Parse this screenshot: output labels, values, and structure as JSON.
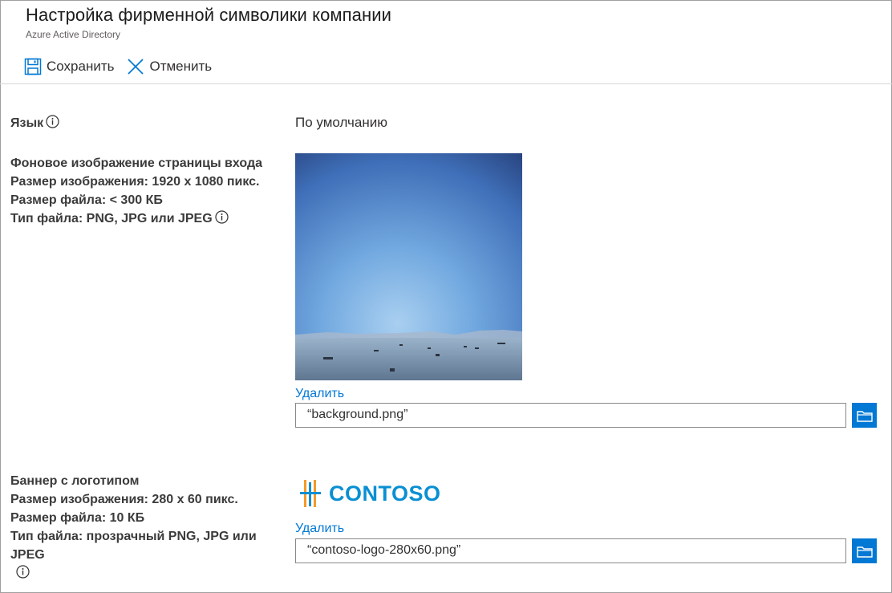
{
  "header": {
    "title": "Настройка фирменной символики компании",
    "subtitle": "Azure Active Directory"
  },
  "toolbar": {
    "save_label": "Сохранить",
    "cancel_label": "Отменить",
    "save_icon": "save-icon",
    "cancel_icon": "close-icon"
  },
  "language": {
    "label": "Язык",
    "value": "По умолчанию"
  },
  "background": {
    "lines": [
      "Фоновое изображение страницы входа",
      "Размер изображения: 1920 x 1080 пикс.",
      "Размер файла: < 300 КБ",
      "Тип файла: PNG, JPG или JPEG"
    ],
    "delete_label": "Удалить",
    "file_value": "“background.png”"
  },
  "banner": {
    "lines": [
      "Баннер с логотипом",
      "Размер изображения: 280 x 60 пикс.",
      "Размер файла: 10 КБ",
      "Тип файла: прозрачный PNG, JPG или",
      "JPEG"
    ],
    "logo_text": "CONTOSO",
    "delete_label": "Удалить",
    "file_value": "“contoso-logo-280x60.png”"
  },
  "colors": {
    "accent": "#0078d4",
    "logo_blue": "#0a8fd3",
    "logo_orange": "#f39a2b"
  }
}
